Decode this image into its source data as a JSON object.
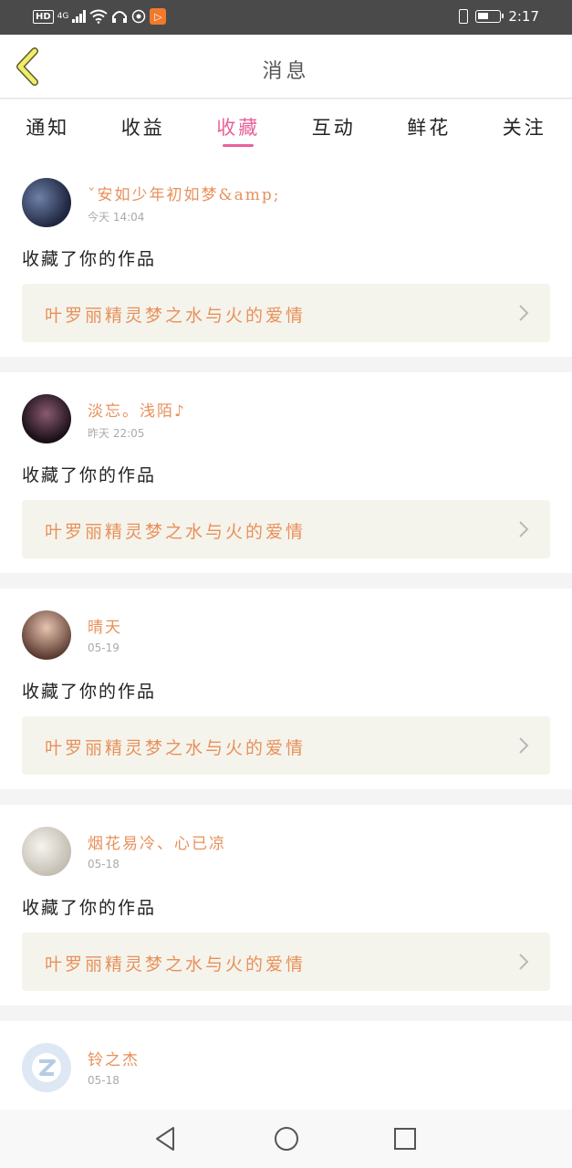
{
  "status_bar": {
    "hd": "HD",
    "network": "4G",
    "time": "2:17",
    "icons": [
      "signal-icon",
      "wifi-icon",
      "headset-icon",
      "vpn-icon",
      "app-icon",
      "vibrate-icon",
      "battery-icon"
    ]
  },
  "header": {
    "title": "消息",
    "back_icon": "back-chevron-icon"
  },
  "tabs": [
    {
      "label": "通知",
      "active": false
    },
    {
      "label": "收益",
      "active": false
    },
    {
      "label": "收藏",
      "active": true
    },
    {
      "label": "互动",
      "active": false
    },
    {
      "label": "鲜花",
      "active": false
    },
    {
      "label": "关注",
      "active": false
    }
  ],
  "messages": [
    {
      "user": "ˇ安如少年初如梦&amp;",
      "time": "今天 14:04",
      "action": "收藏了你的作品",
      "work": "叶罗丽精灵梦之水与火的爱情",
      "avatar_color": "#2c3350"
    },
    {
      "user": "淡忘。浅陌♪",
      "time": "昨天 22:05",
      "action": "收藏了你的作品",
      "work": "叶罗丽精灵梦之水与火的爱情",
      "avatar_color": "#3a2430"
    },
    {
      "user": "晴天",
      "time": "05-19",
      "action": "收藏了你的作品",
      "work": "叶罗丽精灵梦之水与火的爱情",
      "avatar_color": "#8a6a5a"
    },
    {
      "user": "烟花易冷、心已凉",
      "time": "05-18",
      "action": "收藏了你的作品",
      "work": "叶罗丽精灵梦之水与火的爱情",
      "avatar_color": "#d8d4cc"
    },
    {
      "user": "铃之杰",
      "time": "05-18",
      "avatar_color": "#dde8f4"
    }
  ],
  "colors": {
    "accent": "#e8629a",
    "name": "#e8905a",
    "work_bg": "#f5f4ec"
  },
  "navbar": {
    "icons": [
      "nav-back-icon",
      "nav-home-icon",
      "nav-recents-icon"
    ]
  }
}
